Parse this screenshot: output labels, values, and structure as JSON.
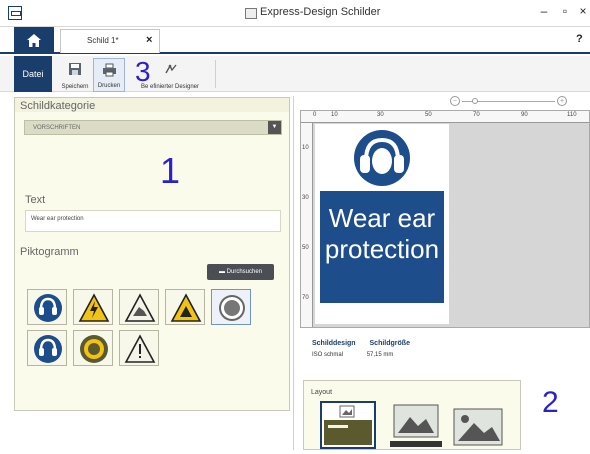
{
  "window": {
    "title": "Express-Design Schilder",
    "minimize": "–",
    "maximize": "▫",
    "close": "×",
    "help": "?"
  },
  "tabs": {
    "doc_tab_label": "Schild 1*",
    "doc_tab_close": "×"
  },
  "ribbon": {
    "file_label": "Datei",
    "save_label": "Speichern",
    "print_label": "Drucken",
    "designer_label": "Benutzerdefinierter Designer",
    "designer_label_visible": "Be    efinierter Designer"
  },
  "left_panel": {
    "category_heading": "Schildkategorie",
    "category_value": "VORSCHRIFTEN",
    "text_heading": "Text",
    "text_value": "Wear ear protection",
    "pictogram_heading": "Piktogramm",
    "browse_label": "Durchsuchen",
    "pictograms": [
      "ear-protection",
      "electric-warning",
      "hand-crush-warning",
      "hazard-warning",
      "ear-protection-selected",
      "ear-protection-2",
      "eye-protection",
      "general-warning"
    ]
  },
  "preview": {
    "ruler_top_ticks": [
      "0",
      "10",
      "30",
      "50",
      "70",
      "90",
      "110"
    ],
    "ruler_left_ticks": [
      "10",
      "30",
      "50",
      "70"
    ],
    "sign_text_line1": "Wear ear",
    "sign_text_line2": "protection",
    "info_design_label": "Schilddesign",
    "info_size_label": "Schildgröße",
    "info_design_value": "ISO schmal",
    "info_size_value": "57,15 mm",
    "layout_label": "Layout"
  },
  "callouts": {
    "one": "1",
    "two": "2",
    "three": "3"
  },
  "colors": {
    "brand": "#1a3e6c",
    "sign_blue": "#1e4d8c",
    "callout": "#2a22c8",
    "panel_bg": "#fbfbec"
  }
}
